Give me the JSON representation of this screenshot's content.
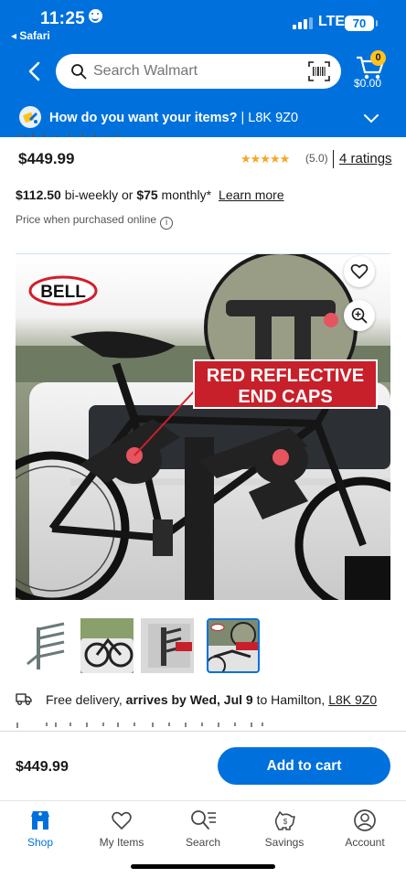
{
  "status_bar": {
    "time": "11:25",
    "back_app": "◂ Safari",
    "network": "LTE",
    "battery": "70"
  },
  "header": {
    "search_placeholder": "Search Walmart",
    "cart_count": "0",
    "cart_total": "$0.00",
    "delivery_question": "How do you want your items?",
    "delivery_postal": " | L8K 9Z0",
    "brand_color": "#0071dc",
    "badge_color": "#ffc220"
  },
  "product": {
    "price": "$449.99",
    "stars": "★★★★★",
    "rating_value": "(5.0)",
    "ratings_link": "4 ratings",
    "financing_amount_biweekly": "$112.50",
    "financing_text_biweekly": " bi-weekly or ",
    "financing_amount_monthly": "$75",
    "financing_text_monthly": " monthly*",
    "learn_more": "Learn more",
    "price_note": "Price when purchased online",
    "image_brand": "BELL",
    "image_callout_line1": "RED REFLECTIVE",
    "image_callout_line2": "END CAPS"
  },
  "delivery": {
    "prefix": "Free delivery, ",
    "arrives": "arrives by Wed, Jul 9",
    "middle": " to Hamilton, ",
    "postal": "L8K 9Z0"
  },
  "cart_bar": {
    "price": "$449.99",
    "add_label": "Add to cart"
  },
  "tabs": [
    {
      "label": "Shop",
      "icon": "shop-icon"
    },
    {
      "label": "My Items",
      "icon": "heart-icon"
    },
    {
      "label": "Search",
      "icon": "search-list-icon"
    },
    {
      "label": "Savings",
      "icon": "savings-icon"
    },
    {
      "label": "Account",
      "icon": "account-icon"
    }
  ]
}
